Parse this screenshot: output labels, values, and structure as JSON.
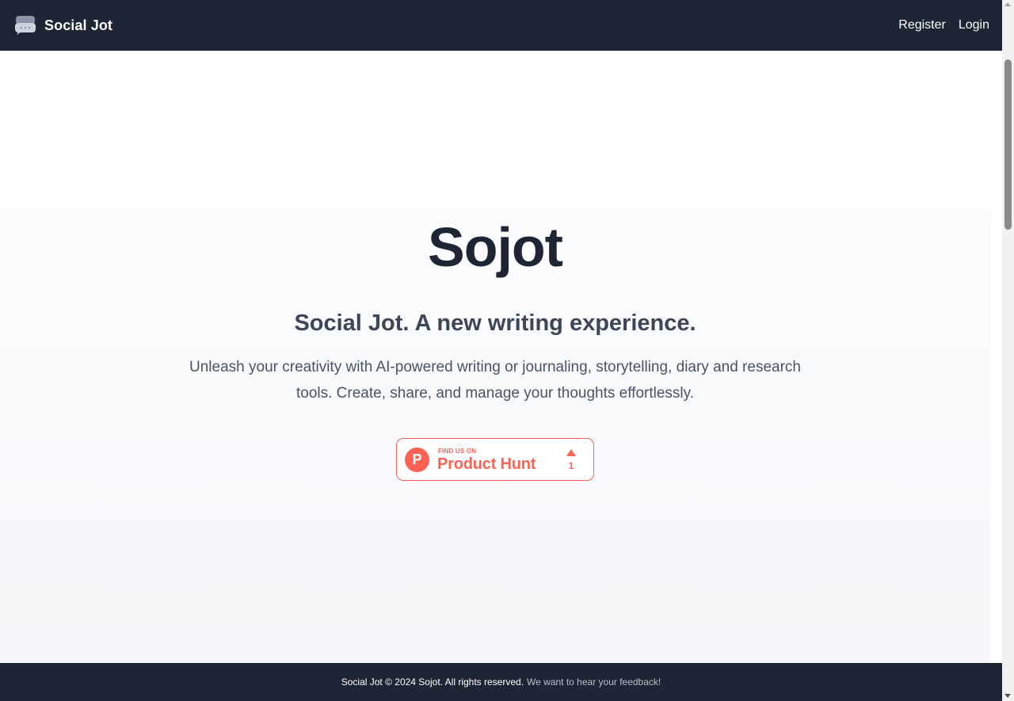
{
  "navbar": {
    "brand": "Social Jot",
    "brand_icon": "chat-bubbles-icon",
    "links": [
      "Register",
      "Login"
    ]
  },
  "hero": {
    "title": "Sojot",
    "subtitle": "Social Jot. A new writing experience.",
    "description": "Unleash your creativity with AI-powered writing or journaling, storytelling, diary and research tools. Create, share, and manage your thoughts effortlessly."
  },
  "product_hunt": {
    "logo_letter": "P",
    "small_text": "FIND US ON",
    "big_text": "Product Hunt",
    "upvotes": "1",
    "upvote_icon": "upvote-triangle-icon",
    "color": "#ff6154"
  },
  "footer": {
    "text": "Social Jot © 2024 Sojot. All rights reserved.",
    "link": "We want to hear your feedback!"
  },
  "colors": {
    "nav_bg": "#1e2636",
    "title": "#1e2636",
    "subtitle": "#3c4658",
    "body_text": "#485465"
  }
}
